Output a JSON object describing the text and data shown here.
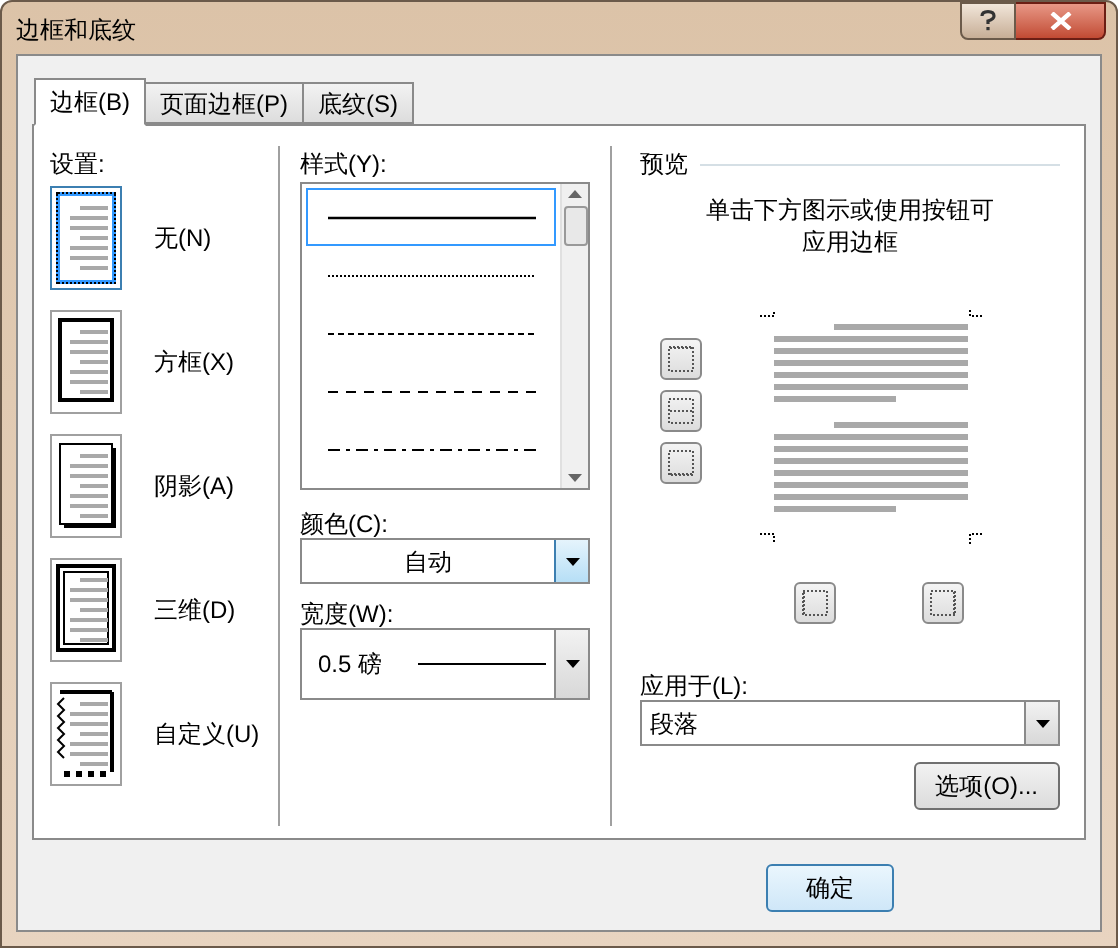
{
  "window": {
    "title": "边框和底纹"
  },
  "tabs": [
    {
      "label": "边框(B)",
      "selected": true
    },
    {
      "label": "页面边框(P)",
      "selected": false
    },
    {
      "label": "底纹(S)",
      "selected": false
    }
  ],
  "settings": {
    "label": "设置:",
    "items": [
      {
        "label": "无(N)",
        "kind": "none",
        "selected": true
      },
      {
        "label": "方框(X)",
        "kind": "box",
        "selected": false
      },
      {
        "label": "阴影(A)",
        "kind": "shadow",
        "selected": false
      },
      {
        "label": "三维(D)",
        "kind": "threed",
        "selected": false
      },
      {
        "label": "自定义(U)",
        "kind": "custom",
        "selected": false
      }
    ]
  },
  "style": {
    "label": "样式(Y):",
    "items": [
      {
        "kind": "solid",
        "selected": true
      },
      {
        "kind": "dotted",
        "selected": false
      },
      {
        "kind": "fine-dash",
        "selected": false
      },
      {
        "kind": "dash",
        "selected": false
      },
      {
        "kind": "dash-dot",
        "selected": false
      }
    ]
  },
  "color": {
    "label": "颜色(C):",
    "value": "自动"
  },
  "width": {
    "label": "宽度(W):",
    "value": "0.5 磅"
  },
  "preview": {
    "title": "预览",
    "hint_lines": [
      "单击下方图示或使用按钮可",
      "应用边框"
    ]
  },
  "apply_to": {
    "label": "应用于(L):",
    "value": "段落"
  },
  "options_button": "选项(O)...",
  "ok_button": "确定"
}
